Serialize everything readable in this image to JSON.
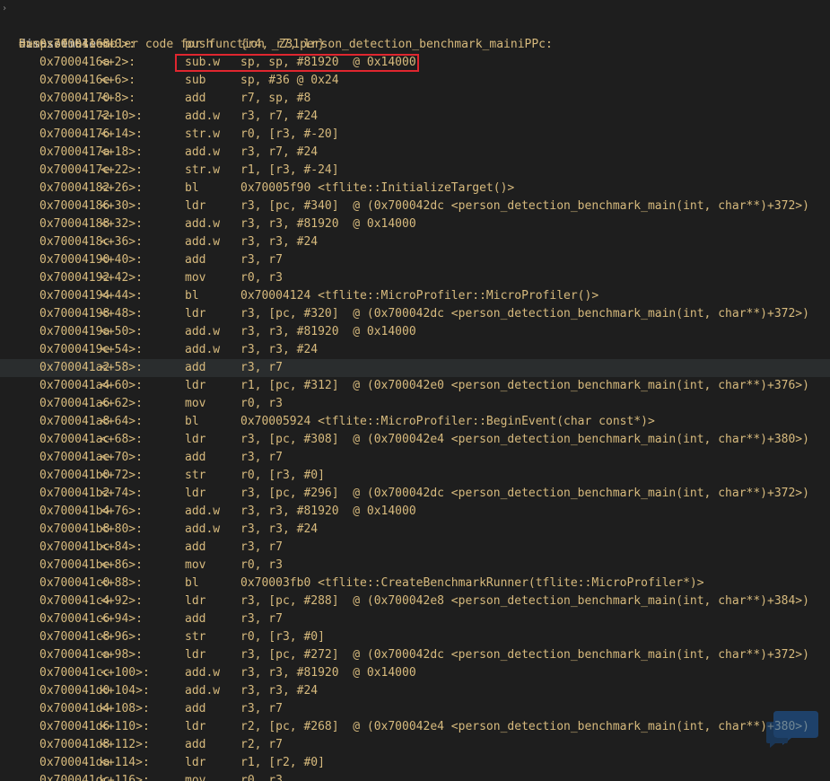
{
  "console": {
    "command": "disassemble",
    "header": "Dump of assembler code for function _Z31person_detection_benchmark_mainiPPc:",
    "current_marker": "=>",
    "highlighted_row_index": 18,
    "boxed_row_index": 1,
    "rows": [
      {
        "addr": "0x70004168",
        "off": "<+0>:",
        "mn": "push",
        "ops": "{r4, r7, lr}"
      },
      {
        "addr": "0x7000416a",
        "off": "<+2>:",
        "mn": "sub.w",
        "ops": "sp, sp, #81920  @ 0x14000"
      },
      {
        "addr": "0x7000416e",
        "off": "<+6>:",
        "mn": "sub",
        "ops": "sp, #36 @ 0x24"
      },
      {
        "addr": "0x70004170",
        "off": "<+8>:",
        "mn": "add",
        "ops": "r7, sp, #8"
      },
      {
        "addr": "0x70004172",
        "off": "<+10>:",
        "mn": "add.w",
        "ops": "r3, r7, #24"
      },
      {
        "addr": "0x70004176",
        "off": "<+14>:",
        "mn": "str.w",
        "ops": "r0, [r3, #-20]"
      },
      {
        "addr": "0x7000417a",
        "off": "<+18>:",
        "mn": "add.w",
        "ops": "r3, r7, #24"
      },
      {
        "addr": "0x7000417e",
        "off": "<+22>:",
        "mn": "str.w",
        "ops": "r1, [r3, #-24]"
      },
      {
        "addr": "0x70004182",
        "off": "<+26>:",
        "mn": "bl",
        "ops": "0x70005f90 <tflite::InitializeTarget()>"
      },
      {
        "addr": "0x70004186",
        "off": "<+30>:",
        "mn": "ldr",
        "ops": "r3, [pc, #340]  @ (0x700042dc <person_detection_benchmark_main(int, char**)+372>)"
      },
      {
        "addr": "0x70004188",
        "off": "<+32>:",
        "mn": "add.w",
        "ops": "r3, r3, #81920  @ 0x14000"
      },
      {
        "addr": "0x7000418c",
        "off": "<+36>:",
        "mn": "add.w",
        "ops": "r3, r3, #24"
      },
      {
        "addr": "0x70004190",
        "off": "<+40>:",
        "mn": "add",
        "ops": "r3, r7"
      },
      {
        "addr": "0x70004192",
        "off": "<+42>:",
        "mn": "mov",
        "ops": "r0, r3"
      },
      {
        "addr": "0x70004194",
        "off": "<+44>:",
        "mn": "bl",
        "ops": "0x70004124 <tflite::MicroProfiler::MicroProfiler()>"
      },
      {
        "addr": "0x70004198",
        "off": "<+48>:",
        "mn": "ldr",
        "ops": "r3, [pc, #320]  @ (0x700042dc <person_detection_benchmark_main(int, char**)+372>)"
      },
      {
        "addr": "0x7000419a",
        "off": "<+50>:",
        "mn": "add.w",
        "ops": "r3, r3, #81920  @ 0x14000"
      },
      {
        "addr": "0x7000419e",
        "off": "<+54>:",
        "mn": "add.w",
        "ops": "r3, r3, #24"
      },
      {
        "addr": "0x700041a2",
        "off": "<+58>:",
        "mn": "add",
        "ops": "r3, r7"
      },
      {
        "addr": "0x700041a4",
        "off": "<+60>:",
        "mn": "ldr",
        "ops": "r1, [pc, #312]  @ (0x700042e0 <person_detection_benchmark_main(int, char**)+376>)"
      },
      {
        "addr": "0x700041a6",
        "off": "<+62>:",
        "mn": "mov",
        "ops": "r0, r3"
      },
      {
        "addr": "0x700041a8",
        "off": "<+64>:",
        "mn": "bl",
        "ops": "0x70005924 <tflite::MicroProfiler::BeginEvent(char const*)>"
      },
      {
        "addr": "0x700041ac",
        "off": "<+68>:",
        "mn": "ldr",
        "ops": "r3, [pc, #308]  @ (0x700042e4 <person_detection_benchmark_main(int, char**)+380>)"
      },
      {
        "addr": "0x700041ae",
        "off": "<+70>:",
        "mn": "add",
        "ops": "r3, r7"
      },
      {
        "addr": "0x700041b0",
        "off": "<+72>:",
        "mn": "str",
        "ops": "r0, [r3, #0]"
      },
      {
        "addr": "0x700041b2",
        "off": "<+74>:",
        "mn": "ldr",
        "ops": "r3, [pc, #296]  @ (0x700042dc <person_detection_benchmark_main(int, char**)+372>)"
      },
      {
        "addr": "0x700041b4",
        "off": "<+76>:",
        "mn": "add.w",
        "ops": "r3, r3, #81920  @ 0x14000"
      },
      {
        "addr": "0x700041b8",
        "off": "<+80>:",
        "mn": "add.w",
        "ops": "r3, r3, #24"
      },
      {
        "addr": "0x700041bc",
        "off": "<+84>:",
        "mn": "add",
        "ops": "r3, r7"
      },
      {
        "addr": "0x700041be",
        "off": "<+86>:",
        "mn": "mov",
        "ops": "r0, r3"
      },
      {
        "addr": "0x700041c0",
        "off": "<+88>:",
        "mn": "bl",
        "ops": "0x70003fb0 <tflite::CreateBenchmarkRunner(tflite::MicroProfiler*)>"
      },
      {
        "addr": "0x700041c4",
        "off": "<+92>:",
        "mn": "ldr",
        "ops": "r3, [pc, #288]  @ (0x700042e8 <person_detection_benchmark_main(int, char**)+384>)"
      },
      {
        "addr": "0x700041c6",
        "off": "<+94>:",
        "mn": "add",
        "ops": "r3, r7"
      },
      {
        "addr": "0x700041c8",
        "off": "<+96>:",
        "mn": "str",
        "ops": "r0, [r3, #0]"
      },
      {
        "addr": "0x700041ca",
        "off": "<+98>:",
        "mn": "ldr",
        "ops": "r3, [pc, #272]  @ (0x700042dc <person_detection_benchmark_main(int, char**)+372>)"
      },
      {
        "addr": "0x700041cc",
        "off": "<+100>:",
        "mn": "add.w",
        "ops": "r3, r3, #81920  @ 0x14000"
      },
      {
        "addr": "0x700041d0",
        "off": "<+104>:",
        "mn": "add.w",
        "ops": "r3, r3, #24"
      },
      {
        "addr": "0x700041d4",
        "off": "<+108>:",
        "mn": "add",
        "ops": "r3, r7"
      },
      {
        "addr": "0x700041d6",
        "off": "<+110>:",
        "mn": "ldr",
        "ops": "r2, [pc, #268]  @ (0x700042e4 <person_detection_benchmark_main(int, char**)+380>)"
      },
      {
        "addr": "0x700041d8",
        "off": "<+112>:",
        "mn": "add",
        "ops": "r2, r7"
      },
      {
        "addr": "0x700041da",
        "off": "<+114>:",
        "mn": "ldr",
        "ops": "r1, [r2, #0]"
      },
      {
        "addr": "0x700041dc",
        "off": "<+116>:",
        "mn": "mov",
        "ops": "r0, r3"
      }
    ]
  }
}
